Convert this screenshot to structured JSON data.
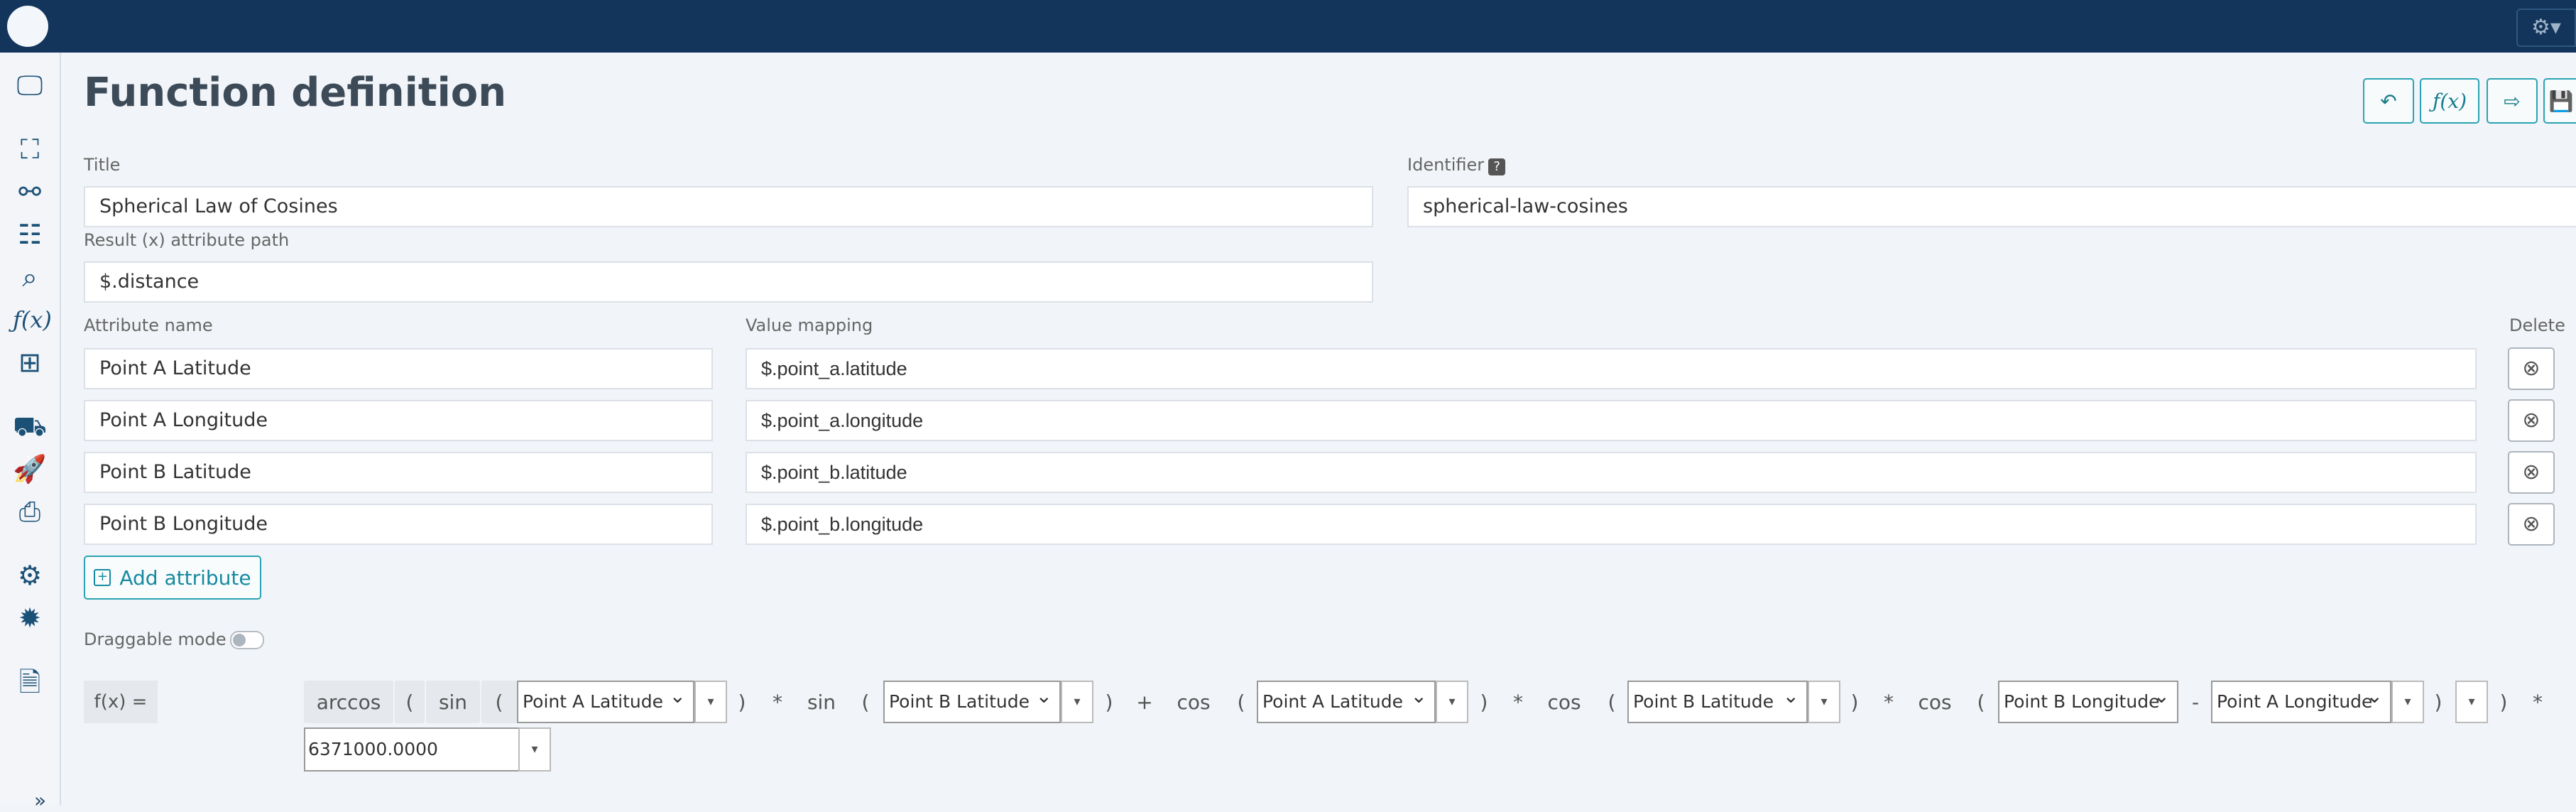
{
  "header": {
    "settings_icon": "⚙▾"
  },
  "sidebar": {
    "items": [
      {
        "name": "dashboard-icon",
        "glyph": "🖵"
      },
      {
        "name": "hierarchy-icon",
        "glyph": "⛶"
      },
      {
        "name": "workflow-icon",
        "glyph": "⚯"
      },
      {
        "name": "table-icon",
        "glyph": "☷"
      },
      {
        "name": "search-inspect-icon",
        "glyph": "⌕"
      },
      {
        "name": "function-icon",
        "glyph": "ƒ(x)"
      },
      {
        "name": "grid-icon",
        "glyph": "⊞"
      },
      {
        "name": "transport-icon",
        "glyph": "⛟"
      },
      {
        "name": "rocket-icon",
        "glyph": "🚀"
      },
      {
        "name": "monitor-check-icon",
        "glyph": "⎙"
      },
      {
        "name": "gear-cycle-icon",
        "glyph": "⚙"
      },
      {
        "name": "cog-icon",
        "glyph": "✹"
      },
      {
        "name": "document-icon",
        "glyph": "🗎"
      }
    ],
    "expand": "»"
  },
  "page": {
    "title": "Function definition"
  },
  "toolbar": [
    {
      "name": "undo-button",
      "glyph": "↶"
    },
    {
      "name": "function-preview-button",
      "glyph": "ƒ(x)"
    },
    {
      "name": "export-button",
      "glyph": "⇨"
    },
    {
      "name": "save-button",
      "glyph": "💾"
    }
  ],
  "form": {
    "title_label": "Title",
    "title_value": "Spherical Law of Cosines",
    "identifier_label": "Identifier",
    "identifier_help": "?",
    "identifier_value": "spherical-law-cosines",
    "result_label": "Result (x) attribute path",
    "result_value": "$.distance"
  },
  "attributes": {
    "name_header": "Attribute name",
    "mapping_header": "Value mapping",
    "delete_header": "Delete",
    "rows": [
      {
        "name": "Point A Latitude",
        "mapping": "$.point_a.latitude"
      },
      {
        "name": "Point A Longitude",
        "mapping": "$.point_a.longitude"
      },
      {
        "name": "Point B Latitude",
        "mapping": "$.point_b.latitude"
      },
      {
        "name": "Point B Longitude",
        "mapping": "$.point_b.longitude"
      }
    ],
    "delete_glyph": "⊗",
    "add_label": "Add attribute",
    "add_glyph": "+"
  },
  "draggable": {
    "label": "Draggable mode",
    "enabled": false
  },
  "formula": {
    "label": "f(x) =",
    "tokens": [
      "arccos",
      "(",
      "sin",
      "(",
      "Point A Latitude",
      ")",
      "*",
      "sin",
      "(",
      "Point B Latitude",
      ")",
      "+",
      "cos",
      "(",
      "Point A Latitude",
      ")",
      "*",
      "cos",
      "(",
      "Point B Latitude",
      ")",
      "*",
      "cos",
      "(",
      "Point B Longitude",
      "-",
      "Point A Longitude",
      ")",
      ")",
      "*"
    ],
    "constant": "6371000.0000",
    "dropdown_glyph": "▾"
  }
}
